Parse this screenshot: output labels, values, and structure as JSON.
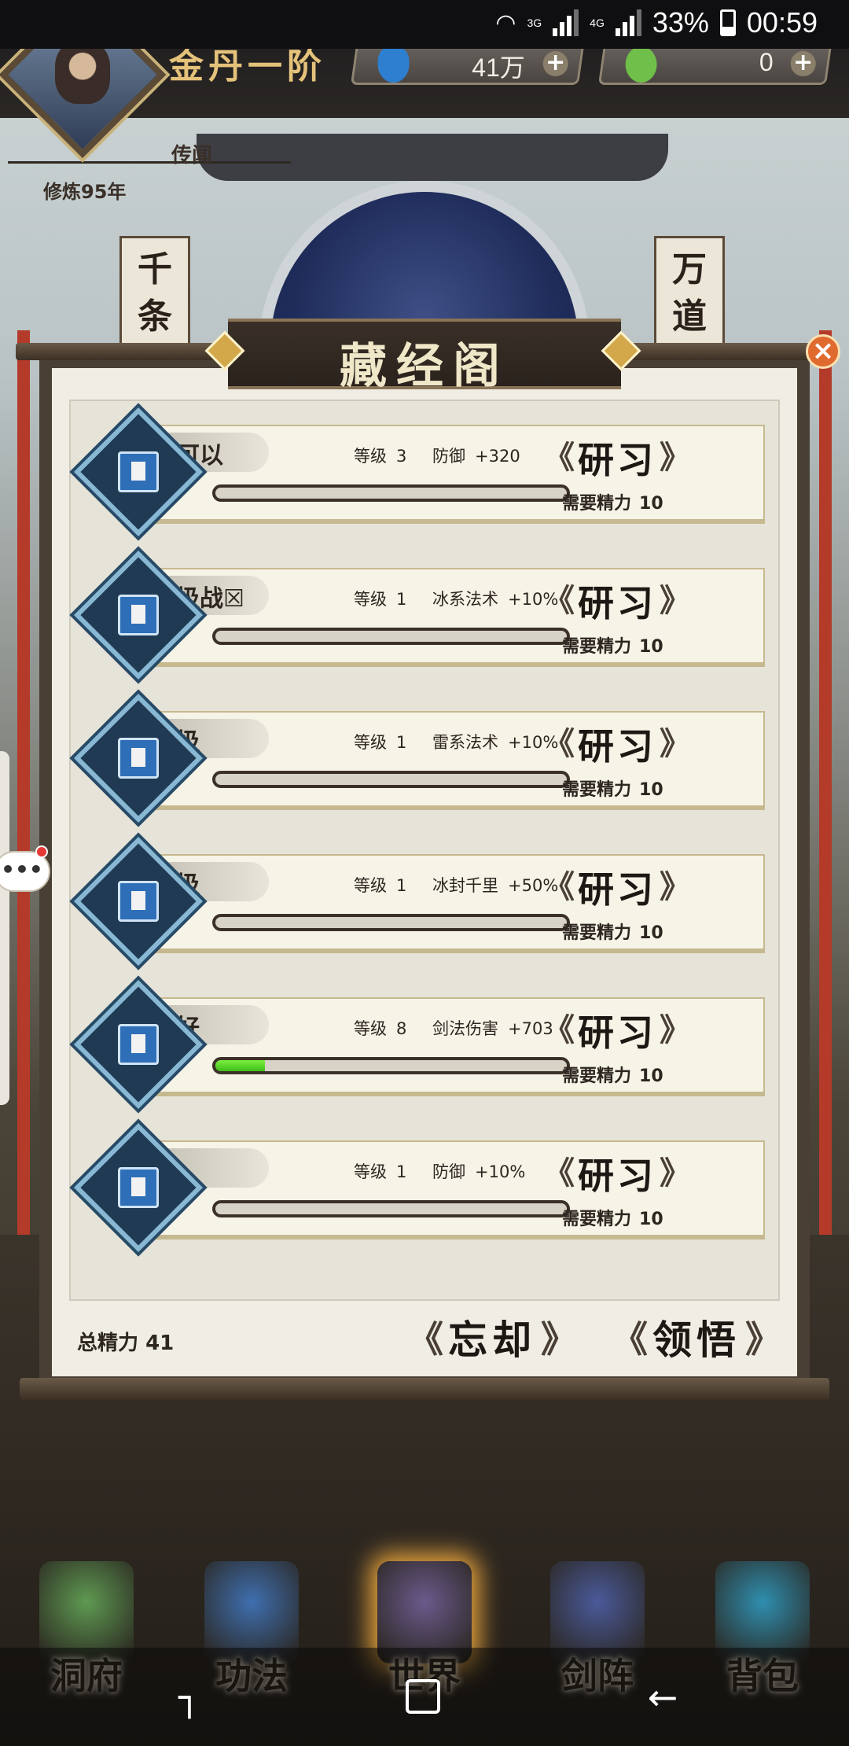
{
  "status_bar": {
    "net_label_1": "3G",
    "net_label_2": "4G",
    "battery_percent": "33%",
    "time": "00:59"
  },
  "player": {
    "rank_title": "金丹一阶",
    "legend_label": "传闻",
    "cultivation_years": "修炼95年"
  },
  "currencies": [
    {
      "icon": "blue-crystal-icon",
      "amount": "41万",
      "color": "#2f7fd0"
    },
    {
      "icon": "jade-stone-icon",
      "amount": "0",
      "color": "#6fbf4a"
    }
  ],
  "background_banners": {
    "left": "千条",
    "right": "万道"
  },
  "panel": {
    "title": "藏经阁",
    "close_icon": "close-x-icon",
    "total_energy_label": "总精力",
    "total_energy_value": "41",
    "forget_button": "忘却",
    "comprehend_button": "领悟"
  },
  "skills": [
    {
      "name": "还可以",
      "level_label": "等级",
      "level": "3",
      "effect_name": "防御",
      "effect_value": "+320",
      "progress": 0,
      "study_label": "研习",
      "cost_label": "需要精力",
      "cost": "10"
    },
    {
      "name": "垃圾战☒",
      "level_label": "等级",
      "level": "1",
      "effect_name": "冰系法术",
      "effect_value": "+10%",
      "progress": 0,
      "study_label": "研习",
      "cost_label": "需要精力",
      "cost": "10"
    },
    {
      "name": "垃圾",
      "level_label": "等级",
      "level": "1",
      "effect_name": "雷系法术",
      "effect_value": "+10%",
      "progress": 0,
      "study_label": "研习",
      "cost_label": "需要精力",
      "cost": "10"
    },
    {
      "name": "垃圾",
      "level_label": "等级",
      "level": "1",
      "effect_name": "冰封千里",
      "effect_value": "+50%",
      "progress": 0,
      "study_label": "研习",
      "cost_label": "需要精力",
      "cost": "10"
    },
    {
      "name": "挺好",
      "level_label": "等级",
      "level": "8",
      "effect_name": "剑法伤害",
      "effect_value": "+703",
      "progress": 0.14,
      "study_label": "研习",
      "cost_label": "需要精力",
      "cost": "10"
    },
    {
      "name": "，，，",
      "level_label": "等级",
      "level": "1",
      "effect_name": "防御",
      "effect_value": "+10%",
      "progress": 0,
      "study_label": "研习",
      "cost_label": "需要精力",
      "cost": "10"
    }
  ],
  "bottom_nav": [
    {
      "label": "洞府",
      "icon": "cave-abode-icon",
      "color": "#5f9a52",
      "active": false
    },
    {
      "label": "功法",
      "icon": "technique-book-icon",
      "color": "#3f6fb0",
      "active": false
    },
    {
      "label": "世界",
      "icon": "world-scroll-icon",
      "color": "#6a5a8c",
      "active": true
    },
    {
      "label": "剑阵",
      "icon": "sword-array-icon",
      "color": "#4a5a9a",
      "active": false
    },
    {
      "label": "背包",
      "icon": "treasure-bag-icon",
      "color": "#2f8fb0",
      "active": false
    }
  ],
  "chat": {
    "bubble_text": "•••"
  },
  "system_nav": {
    "recents_icon": "recents-icon",
    "home_icon": "home-icon",
    "back_icon": "back-arrow-icon"
  }
}
